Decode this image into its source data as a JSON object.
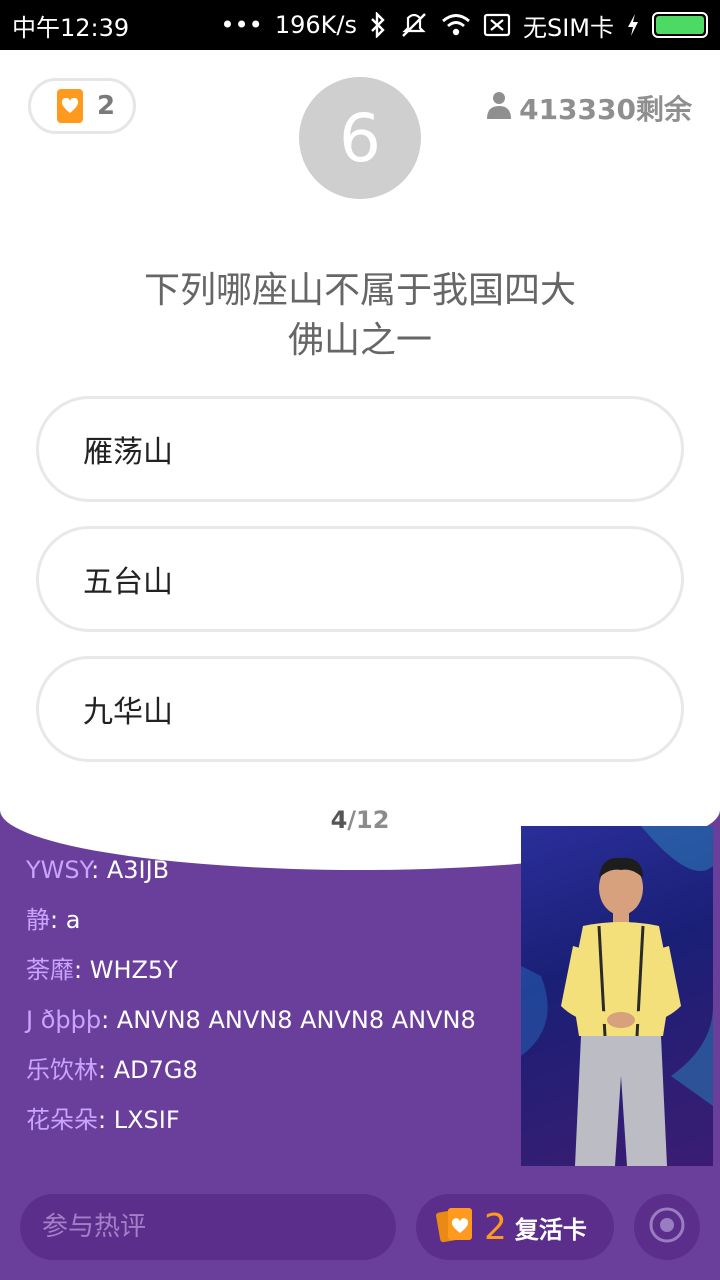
{
  "status_bar": {
    "time": "中午12:39",
    "dots": "•••",
    "speed": "196K/s",
    "sim": "无SIM卡",
    "icons": [
      "bluetooth-icon",
      "vibrate-off-icon",
      "wifi-icon",
      "no-sim-icon",
      "charging-icon",
      "battery-icon"
    ],
    "battery_color": "#4cd964"
  },
  "header": {
    "lives_count": "2",
    "timer": "6",
    "remaining_count": "413330剩余"
  },
  "question": {
    "line1": "下列哪座山不属于我国四大",
    "line2": "佛山之一"
  },
  "options": [
    {
      "label": "雁荡山"
    },
    {
      "label": "五台山"
    },
    {
      "label": "九华山"
    }
  ],
  "progress": {
    "current": "4",
    "total": "/12"
  },
  "chat": [
    {
      "user": "YWSY",
      "message": ": A3IJB"
    },
    {
      "user": "静",
      "message": ": a"
    },
    {
      "user": "荼靡",
      "message": ": WHZ5Y"
    },
    {
      "user": "J ðþþþ",
      "message": ": ANVN8 ANVN8 ANVN8 ANVN8"
    },
    {
      "user": "乐饮林",
      "message": ": AD7G8"
    },
    {
      "user": "花朵朵",
      "message": ": LXSIF"
    }
  ],
  "bottom": {
    "comment_placeholder": "参与热评",
    "revive_count": "2",
    "revive_label": "复活卡"
  },
  "colors": {
    "purple_bg": "#6a3f9c",
    "accent_orange": "#ff9a1f",
    "chat_user": "#c9a3ff"
  }
}
